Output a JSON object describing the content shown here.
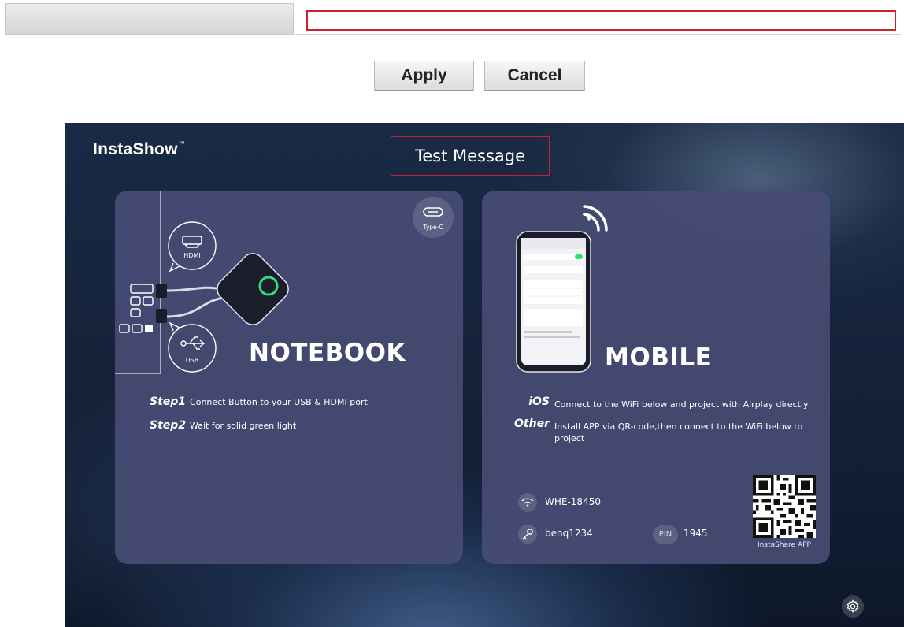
{
  "form": {
    "message_value": "",
    "apply_label": "Apply",
    "cancel_label": "Cancel"
  },
  "preview": {
    "brand": "InstaShow",
    "brand_tm": "™",
    "message": "Test Message",
    "notebook": {
      "hdmi_label": "HDMI",
      "usb_label": "USB",
      "typec_label": "Type-C",
      "heading": "NOTEBOOK",
      "steps": [
        {
          "key": "Step1",
          "text": "Connect Button to your USB & HDMI port"
        },
        {
          "key": "Step2",
          "text": "Wait for solid green light"
        }
      ]
    },
    "mobile": {
      "heading": "MOBILE",
      "rows": [
        {
          "key": "iOS",
          "text": "Connect to the WiFi below and project with Airplay directly"
        },
        {
          "key": "Other",
          "text": "Install APP via QR-code,then connect to the WiFi below to project"
        }
      ],
      "ssid": "WHE-18450",
      "password": "benq1234",
      "pin_label": "PIN",
      "pin": "1945",
      "qr_caption": "InstaShare APP"
    }
  },
  "colors": {
    "highlight_border": "#c8232c",
    "card_bg": "#484c74",
    "led_green": "#2fe07a"
  },
  "icons": [
    "hdmi-icon",
    "usb-icon",
    "type-c-icon",
    "wifi-signal-icon",
    "wifi-icon",
    "key-icon",
    "settings-gear-icon",
    "qr-code"
  ]
}
